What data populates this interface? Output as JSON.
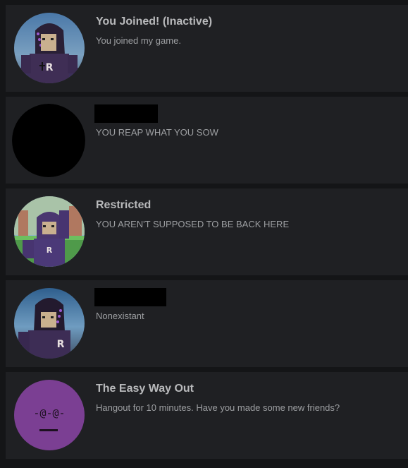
{
  "badges": [
    {
      "title": "You Joined! (Inactive)",
      "description": "You joined my game.",
      "icon": "avatar-purple-hood-icon"
    },
    {
      "title": "",
      "description": "YOU REAP WHAT YOU SOW",
      "icon": "black-circle-icon"
    },
    {
      "title": "Restricted",
      "description": "YOU AREN'T SUPPOSED TO BE BACK HERE",
      "icon": "avatar-field-icon"
    },
    {
      "title": "",
      "description": "Nonexistant",
      "icon": "avatar-sky-icon"
    },
    {
      "title": "The Easy Way Out",
      "description": "Hangout for 10 minutes. Have you made some new friends?",
      "icon": "purple-face-icon",
      "face_text": "-@-@-"
    }
  ],
  "colors": {
    "page_bg": "#141517",
    "card_bg": "#1f2023",
    "title": "#b8b9bb",
    "description": "#9d9fa2",
    "accent_purple": "#7b3f93"
  }
}
